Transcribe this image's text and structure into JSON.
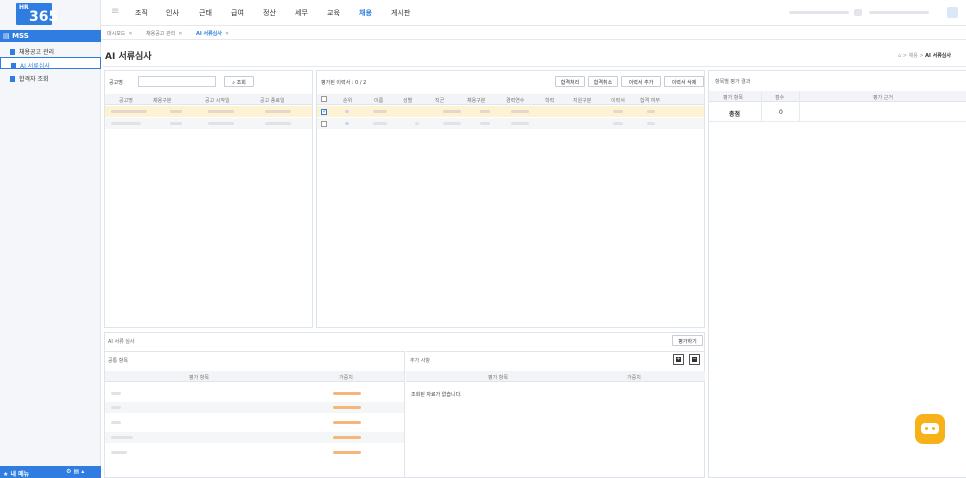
{
  "logo": {
    "hr": "HR",
    "num": "365"
  },
  "sidebar": {
    "section": "MSS",
    "items": [
      {
        "label": "채용공고 관리"
      },
      {
        "label": "AI 서류심사"
      },
      {
        "label": "합격자 조회"
      }
    ],
    "footer": "내 메뉴"
  },
  "topnav": [
    "조직",
    "인사",
    "근태",
    "급여",
    "정산",
    "세무",
    "교육",
    "채용",
    "게시판"
  ],
  "tabs": [
    {
      "label": "대시보드"
    },
    {
      "label": "채용공고 관리"
    },
    {
      "label": "AI 서류심사"
    }
  ],
  "page": {
    "title": "AI 서류심사",
    "breadcrumb": [
      "채용",
      "AI 서류심사"
    ]
  },
  "left_panel": {
    "search_label": "공고명",
    "search_button": "조회",
    "headers": [
      "공고명",
      "채용구분",
      "공고 시작일",
      "공고 종료일"
    ]
  },
  "middle_panel": {
    "count_label": "평가된 이력서 : 0 / 2",
    "buttons": [
      "합격처리",
      "합격취소",
      "이력서 추가",
      "이력서 삭제"
    ],
    "headers": [
      "순위",
      "이름",
      "성별",
      "직군",
      "채용구분",
      "경력연수",
      "학력",
      "지원구분",
      "이력서",
      "합격 여부"
    ]
  },
  "right_panel": {
    "title": "항목별 평가 결과",
    "headers": [
      "평가 항목",
      "점수",
      "평가 근거"
    ],
    "total_label": "총점",
    "total_score": "0"
  },
  "ai_section": {
    "title": "AI 서류 심사",
    "evaluate_button": "평가하기",
    "common": {
      "title": "공통 항목",
      "headers": [
        "평가 항목",
        "가중치"
      ]
    },
    "extra": {
      "title": "추가 사항",
      "headers": [
        "평가 항목",
        "가중치"
      ],
      "empty": "조회된 자료가 없습니다."
    }
  },
  "colors": {
    "accent": "#2f7de1",
    "highlight_row": "#fdf2d3",
    "bot": "#f7b21a"
  }
}
